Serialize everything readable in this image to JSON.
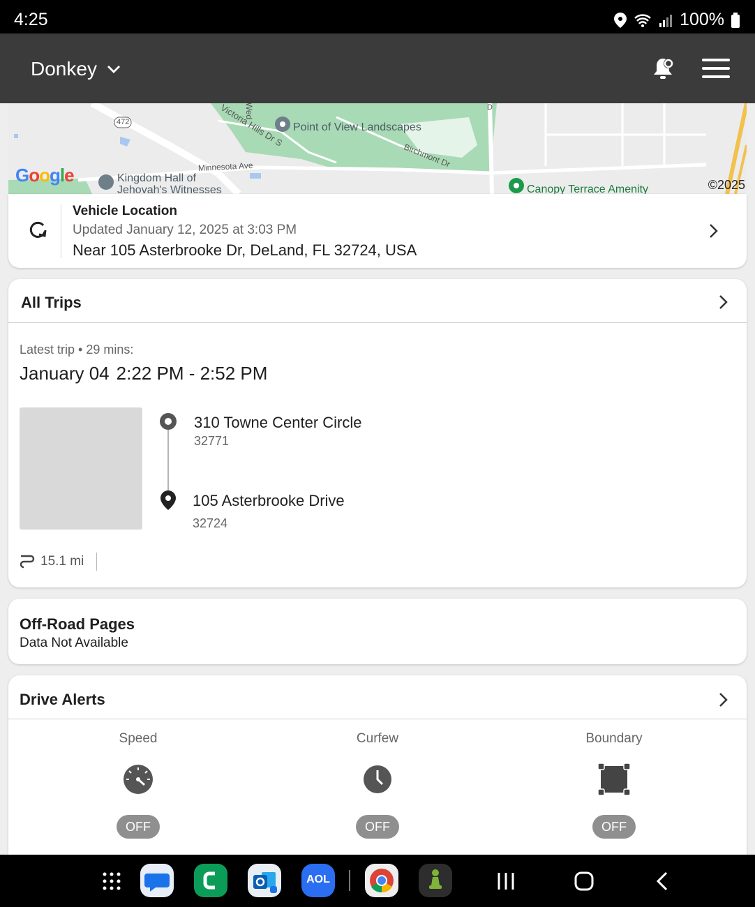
{
  "status_bar": {
    "time": "4:25",
    "battery": "100%"
  },
  "header": {
    "vehicle_name": "Donkey"
  },
  "map": {
    "labels": {
      "route_472": "472",
      "victoria_hills": "Victoria Hills Dr S",
      "wed": "Wed",
      "poi_point_of_view": "Point of View Landscapes",
      "birchmont": "Birchmont Dr",
      "minnesota": "Minnesota Ave",
      "kingdom_hall_1": "Kingdom Hall of",
      "kingdom_hall_2": "Jehovah's Witnesses",
      "canopy": "Canopy Terrace Amenity",
      "d_road": "D"
    },
    "logo": "Google",
    "copyright": "©2025"
  },
  "vehicle_location": {
    "title": "Vehicle Location",
    "updated": "Updated January 12, 2025 at 3:03 PM",
    "address": "Near 105 Asterbrooke Dr, DeLand, FL 32724, USA"
  },
  "trips": {
    "title": "All Trips",
    "latest_meta": "Latest trip • 29 mins:",
    "date": "January 04",
    "time_range": "2:22 PM - 2:52 PM",
    "start": {
      "name": "310 Towne Center Circle",
      "zip": "32771"
    },
    "end": {
      "name": "105 Asterbrooke Drive",
      "zip": "32724"
    },
    "distance": "15.1 mi"
  },
  "offroad": {
    "title": "Off-Road Pages",
    "subtitle": "Data Not Available"
  },
  "drive_alerts": {
    "title": "Drive Alerts",
    "items": [
      {
        "label": "Speed",
        "state": "OFF"
      },
      {
        "label": "Curfew",
        "state": "OFF"
      },
      {
        "label": "Boundary",
        "state": "OFF"
      }
    ]
  },
  "dock": {
    "aol_label": "AOL"
  },
  "colors": {
    "header_bg": "#3b3b3b",
    "toggle_off": "#8f8f8f",
    "map_green": "#a8dab5",
    "poi_green": "#1b7a3b"
  }
}
